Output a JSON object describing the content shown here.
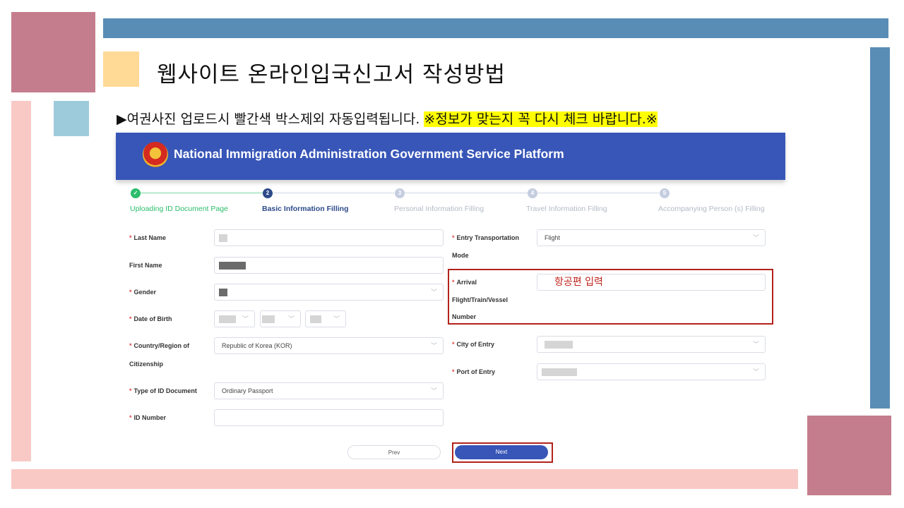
{
  "slide": {
    "title": "웹사이트 온라인입국신고서 작성방법",
    "note_prefix": "▶여권사진 업로드시 빨간색 박스제외 자동입력됩니다. ",
    "note_highlight": "※정보가 맞는지 꼭 다시 체크 바랍니다.※",
    "colors": {
      "rose": "#c47d8c",
      "blue_bar": "#5a8db5",
      "peach": "#ffd996",
      "light_blue": "#9ecbdc",
      "pink": "#f9c9c5"
    }
  },
  "app": {
    "title": "National Immigration Administration Government Service Platform",
    "banner_color": "#3856b8"
  },
  "steps": [
    {
      "number": "✓",
      "label": "Uploading ID Document Page",
      "state": "done"
    },
    {
      "number": "2",
      "label": "Basic Information Filling",
      "state": "active"
    },
    {
      "number": "3",
      "label": "Personal Information Filling",
      "state": "pending"
    },
    {
      "number": "4",
      "label": "Travel Information Filling",
      "state": "pending"
    },
    {
      "number": "5",
      "label": "Accompanying Person (s) Filling",
      "state": "pending"
    }
  ],
  "form": {
    "last_name": {
      "label": "Last Name",
      "required": "*"
    },
    "first_name": {
      "label": "First Name"
    },
    "gender": {
      "label": "Gender",
      "required": "*"
    },
    "dob": {
      "label": "Date of Birth",
      "required": "*"
    },
    "country": {
      "label_line1": "Country/Region of",
      "label_line2": "Citizenship",
      "required": "*",
      "value": "Republic of Korea (KOR)"
    },
    "id_type": {
      "label": "Type of ID Document",
      "required": "*",
      "value": "Ordinary Passport"
    },
    "id_number": {
      "label": "ID Number",
      "required": "*"
    },
    "transport": {
      "label_line1": "Entry Transportation",
      "label_line2": "Mode",
      "required": "*",
      "value": "Flight"
    },
    "arrival": {
      "label_line1": "Arrival",
      "label_line2": "Flight/Train/Vessel",
      "label_line3": "Number",
      "required": "*",
      "annotation": "항공편 입력"
    },
    "city": {
      "label": "City of Entry",
      "required": "*"
    },
    "port": {
      "label": "Port of Entry",
      "required": "*"
    }
  },
  "buttons": {
    "prev": "Prev",
    "next": "Next"
  }
}
